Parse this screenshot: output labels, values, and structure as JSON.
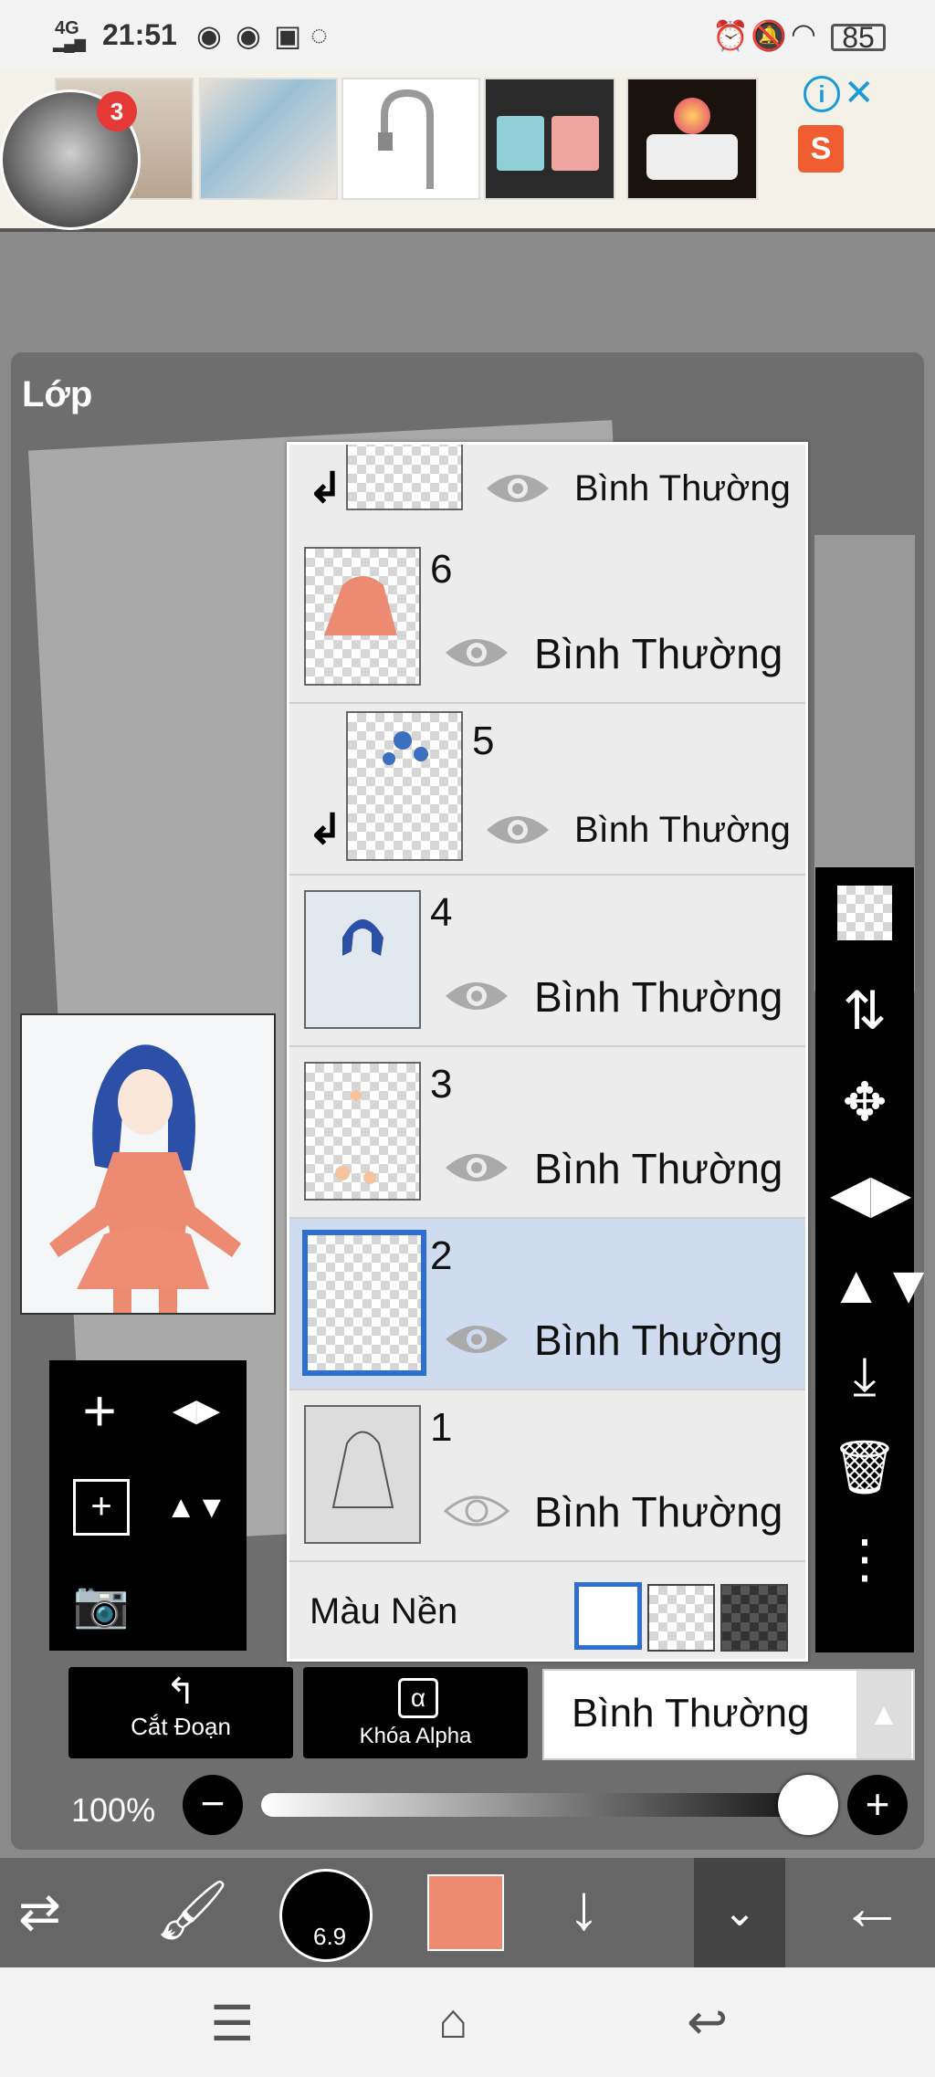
{
  "status": {
    "network": "4G",
    "time": "21:51",
    "battery": "85"
  },
  "notification_badge": "3",
  "panel": {
    "title": "Lớp"
  },
  "layers": [
    {
      "num": "",
      "blend": "Bình Thường",
      "clipped": true,
      "visible": true
    },
    {
      "num": "6",
      "blend": "Bình Thường",
      "clipped": false,
      "visible": true
    },
    {
      "num": "5",
      "blend": "Bình Thường",
      "clipped": true,
      "visible": true
    },
    {
      "num": "4",
      "blend": "Bình Thường",
      "clipped": false,
      "visible": true
    },
    {
      "num": "3",
      "blend": "Bình Thường",
      "clipped": false,
      "visible": true
    },
    {
      "num": "2",
      "blend": "Bình Thường",
      "clipped": false,
      "visible": true,
      "selected": true
    },
    {
      "num": "1",
      "blend": "Bình Thường",
      "clipped": false,
      "visible": false
    }
  ],
  "background_label": "Màu Nền",
  "buttons": {
    "clipping": "Cắt Đoạn",
    "alpha_lock": "Khóa Alpha"
  },
  "blend_mode": {
    "selected": "Bình Thường"
  },
  "opacity": {
    "label": "100%",
    "value": 100
  },
  "brush_size": "6.9",
  "colors": {
    "current": "#ec8a72",
    "selection": "#2f6fd4",
    "selected_row": "#cfdcef",
    "shopee": "#f05d30"
  }
}
